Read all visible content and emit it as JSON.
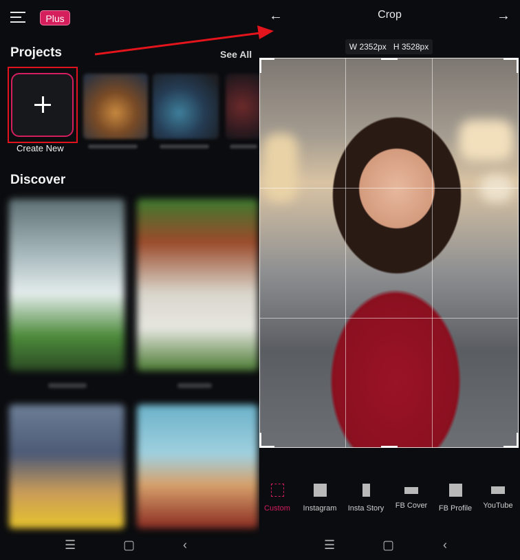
{
  "left_screen": {
    "badge": "Plus",
    "projects_title": "Projects",
    "see_all": "See All",
    "create_new": "Create New",
    "discover_title": "Discover"
  },
  "right_screen": {
    "title": "Crop",
    "width_label": "W 2352px",
    "height_label": "H 3528px",
    "tools": [
      {
        "label": "Custom",
        "active": true
      },
      {
        "label": "Instagram",
        "active": false
      },
      {
        "label": "Insta Story",
        "active": false
      },
      {
        "label": "FB Cover",
        "active": false
      },
      {
        "label": "FB Profile",
        "active": false
      },
      {
        "label": "YouTube",
        "active": false
      }
    ]
  },
  "colors": {
    "background": "#0b0c0f",
    "accent": "#d51e5c",
    "highlight_box": "#e0131f",
    "annotation_arrow": "#e3141c"
  }
}
